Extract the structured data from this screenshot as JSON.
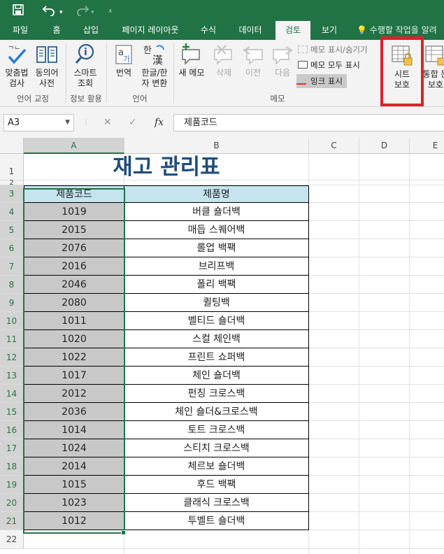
{
  "titlebar": {
    "save_icon": "save-icon",
    "undo_icon": "undo-icon",
    "redo_icon": "redo-icon",
    "customize_icon": "customize-qat-icon"
  },
  "tabs": [
    {
      "label": "파일"
    },
    {
      "label": "홈"
    },
    {
      "label": "삽입"
    },
    {
      "label": "페이지 레이아웃"
    },
    {
      "label": "수식"
    },
    {
      "label": "데이터"
    },
    {
      "label": "검토",
      "active": true
    },
    {
      "label": "보기"
    }
  ],
  "tell_me": "수행할 작업을 알려",
  "ribbon": {
    "spelling": "맞춤법\n검사",
    "thesaurus": "동의어\n사전",
    "smart_lookup": "스마트\n조회",
    "translate": "번역",
    "hanja": "한글/한\n자 변환",
    "new_comment": "새 메모",
    "delete": "삭제",
    "previous": "이전",
    "next": "다음",
    "show_hide_comment": "메모 표시/숨기기",
    "show_all_comments": "메모 모두 표시",
    "show_ink": "잉크 표시",
    "protect_sheet": "시트\n보호",
    "protect_shared": "통합 문\n보호",
    "groups": {
      "proofing": "언어 교정",
      "insights": "정보 활용",
      "language": "언어",
      "comments": "메모"
    }
  },
  "formula_bar": {
    "name_box": "A3",
    "cancel": "✕",
    "enter": "✓",
    "fx": "fx",
    "content": "제품코드"
  },
  "columns": [
    "A",
    "B",
    "C",
    "D",
    "E"
  ],
  "rows": [
    "1",
    "2",
    "3",
    "4",
    "5",
    "6",
    "7",
    "8",
    "9",
    "10",
    "11",
    "12",
    "13",
    "14",
    "15",
    "16",
    "17",
    "18",
    "19",
    "20",
    "21",
    "22"
  ],
  "sheet": {
    "title": "재고 관리표",
    "header": [
      "제품코드",
      "제품명"
    ],
    "data": [
      [
        "1019",
        "버클 숄더백"
      ],
      [
        "2015",
        "매듭 스퀘어백"
      ],
      [
        "2076",
        "롤업 백팩"
      ],
      [
        "2016",
        "브리프백"
      ],
      [
        "2046",
        "폴리 백팩"
      ],
      [
        "2080",
        "퀼팅백"
      ],
      [
        "1011",
        "벨티드 숄더백"
      ],
      [
        "1020",
        "스컬 체인백"
      ],
      [
        "1022",
        "프린트 쇼퍼백"
      ],
      [
        "1017",
        "체인 숄더백"
      ],
      [
        "2012",
        "펀칭 크로스백"
      ],
      [
        "2036",
        "체인 숄더&크로스백"
      ],
      [
        "1014",
        "토트 크로스백"
      ],
      [
        "1024",
        "스티치 크로스백"
      ],
      [
        "2014",
        "체르보 숄더백"
      ],
      [
        "1015",
        "후드 백팩"
      ],
      [
        "1023",
        "클래식 크로스백"
      ],
      [
        "1012",
        "투벨트 숄더백"
      ]
    ]
  },
  "colors": {
    "brand": "#217346",
    "header_fill": "#c5e4ee",
    "code_fill": "#c8c8c8",
    "title_color": "#1f4e79",
    "highlight_box": "#e0202a"
  }
}
